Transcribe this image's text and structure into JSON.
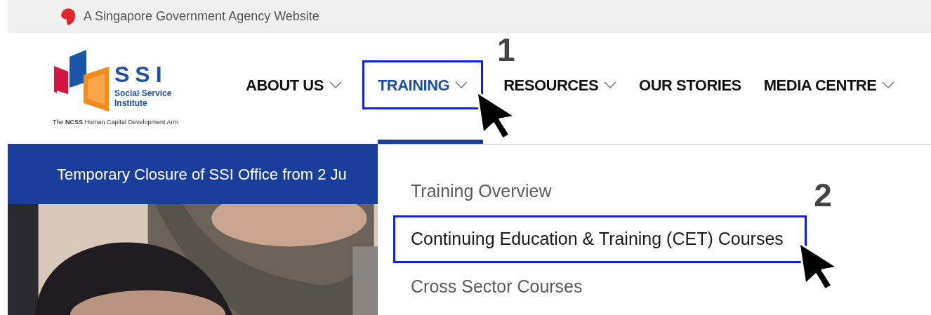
{
  "gov_banner": {
    "text": "A Singapore Government Agency Website"
  },
  "logo": {
    "title": "SSI",
    "subtitle_lines": [
      "Social Service",
      "Institute"
    ],
    "tagline": "The **NCSS** Human Capital Development Arm"
  },
  "nav": [
    {
      "label": "ABOUT US",
      "has_dropdown": true,
      "selected": false
    },
    {
      "label": "TRAINING",
      "has_dropdown": true,
      "selected": true,
      "step": "1"
    },
    {
      "label": "RESOURCES",
      "has_dropdown": true,
      "selected": false
    },
    {
      "label": "OUR STORIES",
      "has_dropdown": false,
      "selected": false
    },
    {
      "label": "MEDIA CENTRE",
      "has_dropdown": true,
      "selected": false
    }
  ],
  "announcement": {
    "text": "Temporary Closure of SSI Office from 2 Ju"
  },
  "dropdown": {
    "items": [
      {
        "label": "Training Overview",
        "hovered": false
      },
      {
        "label": "Continuing Education & Training (CET) Courses",
        "hovered": true,
        "step": "2"
      },
      {
        "label": "Cross Sector Courses",
        "hovered": false
      }
    ]
  }
}
